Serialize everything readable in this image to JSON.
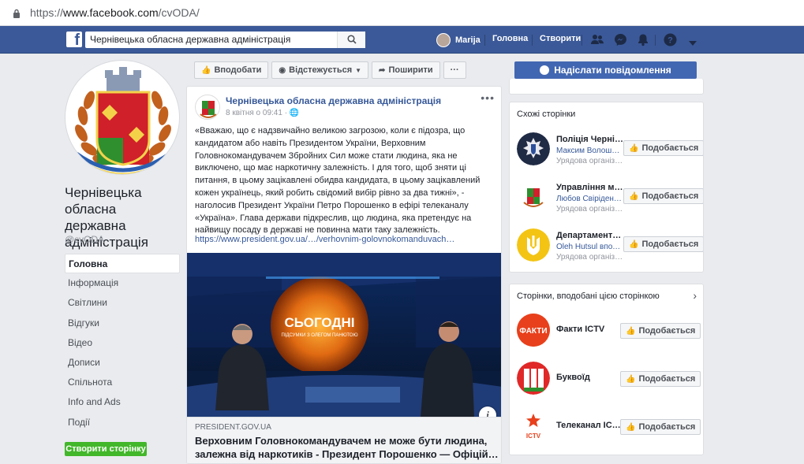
{
  "browser": {
    "url_scheme": "https://",
    "url_host": "www.facebook.com",
    "url_path": "/cvODA/"
  },
  "topbar": {
    "search_value": "Чернівецька обласна державна адміністрація",
    "user_name": "Marija",
    "nav_home": "Головна",
    "nav_create": "Створити",
    "brand_color": "#3b5998"
  },
  "page": {
    "name": "Чернівецька обласна державна адміністрація",
    "handle": "@cvODA",
    "nav": [
      {
        "label": "Головна"
      },
      {
        "label": "Інформація"
      },
      {
        "label": "Світлини"
      },
      {
        "label": "Відгуки"
      },
      {
        "label": "Відео"
      },
      {
        "label": "Дописи"
      },
      {
        "label": "Спільнота"
      },
      {
        "label": "Info and Ads"
      },
      {
        "label": "Події"
      }
    ],
    "create_page": "Створити сторінку"
  },
  "actions": {
    "like": "Вподобати",
    "follow": "Відстежується",
    "share": "Поширити",
    "more": "···",
    "send_message": "Надіслати повідомлення"
  },
  "post": {
    "author": "Чернівецька обласна державна адміністрація",
    "date": "8 квітня о 09:41 · ",
    "text": "«Вважаю, що є надзвичайно великою загрозою, коли є підозра, що кандидатом або навіть Президентом України, Верховним Головнокомандувачем Збройних Сил може стати людина, яка не виключено, що має наркотичну залежність. І для того, щоб зняти ці питання, в цьому зацікавлені обидва кандидата, в цьому зацікавлений кожен українець, який робить свідомий вибір рівно за два тижні», - наголосив Президент України Петро Порошенко в ефірі телеканалу «Україна». Глава держави підкреслив, що людина, яка претендує на найвищу посаду в державі не повинна мати таку залежність.",
    "link_url": "https://www.president.gov.ua/…/verhovnim-golovnokomanduvach…",
    "image_caption_title": "СЬОГОДНІ",
    "image_caption_sub": "ПІДСУМКИ\nЗ ОЛЕГОМ ПАНЮТОЮ",
    "link_domain": "PRESIDENT.GOV.UA",
    "link_title": "Верховним Головнокомандувачем не може бути людина, залежна від наркотиків - Президент Порошенко — Офіцій…"
  },
  "similar": {
    "title": "Схожі сторінки",
    "items": [
      {
        "name": "Поліція Черні…",
        "sub": "Максим Волош…",
        "category": "Урядова організ…",
        "button": "Подобається"
      },
      {
        "name": "Управління м…",
        "sub": "Любов Свірiден…",
        "category": "Урядова організ…",
        "button": "Подобається"
      },
      {
        "name": "Департамент…",
        "sub": "Oleh Hutsul вподо…",
        "category": "Урядова організ…",
        "button": "Подобається"
      }
    ]
  },
  "liked": {
    "title": "Сторінки, вподобані цією сторінкою",
    "items": [
      {
        "name": "Факти ICTV",
        "logo": "ФАКТИ",
        "button": "Подобається"
      },
      {
        "name": "Буквоїд",
        "button": "Подобається"
      },
      {
        "name": "Телеканал IC…",
        "logo": "ICTV",
        "button": "Подобається"
      }
    ]
  }
}
